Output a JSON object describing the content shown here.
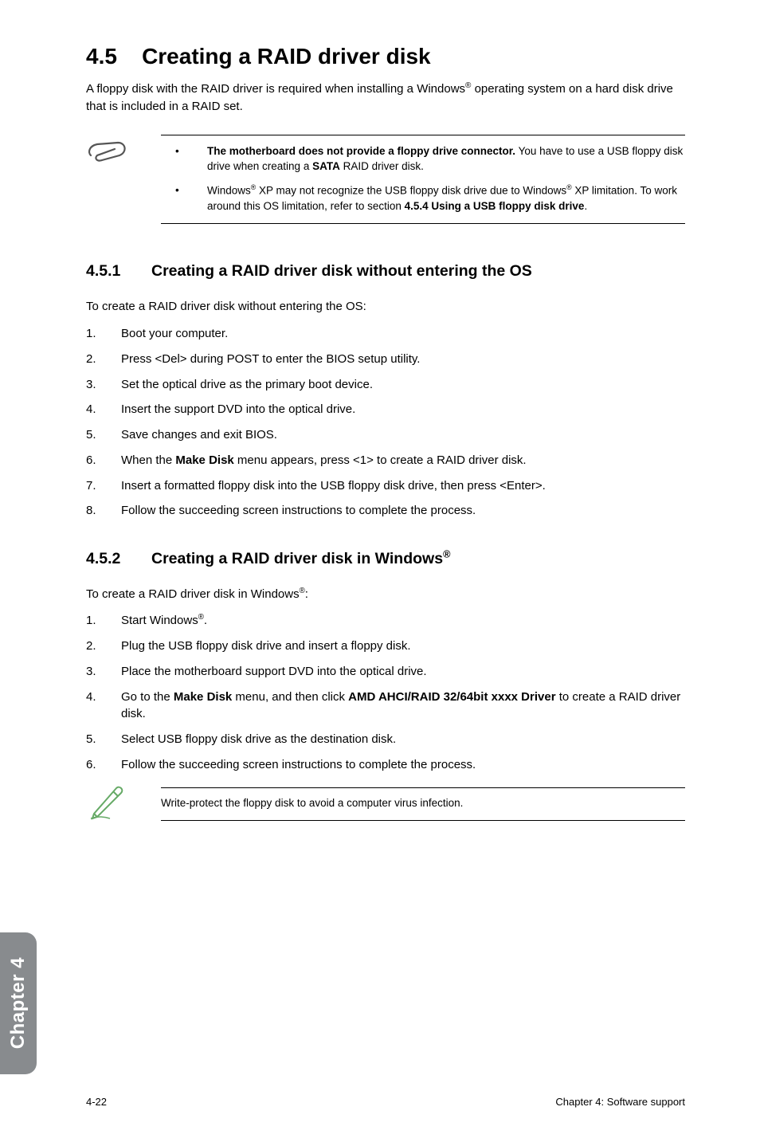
{
  "title": {
    "num": "4.5",
    "text": "Creating a RAID driver disk"
  },
  "intro": "A floppy disk with the RAID driver is required when installing a Windows® operating system on a hard disk drive that is included in a RAID set.",
  "note_items": [
    "<b>The motherboard does not provide a floppy drive connector.</b> You have to use a USB floppy disk drive when creating a <b>SATA</b> RAID driver disk.",
    "Windows<sup>®</sup> XP may not recognize the USB floppy disk drive due to Windows<sup>®</sup> XP limitation. To work around this OS limitation, refer to section <b>4.5.4 Using a USB floppy disk drive</b>."
  ],
  "sub1": {
    "num": "4.5.1",
    "title": "Creating a RAID driver disk without entering the OS",
    "lead": "To create a RAID driver disk without entering the OS:",
    "steps": [
      "Boot your computer.",
      "Press <Del> during POST to enter the BIOS setup utility.",
      "Set the optical drive as the primary boot device.",
      "Insert the support DVD into the optical drive.",
      "Save changes and exit BIOS.",
      "When the <b>Make Disk</b> menu appears, press <1> to create a RAID driver disk.",
      "Insert a formatted floppy disk into the USB floppy disk drive, then press <Enter>.",
      "Follow the succeeding screen instructions to complete the process."
    ]
  },
  "sub2": {
    "num": "4.5.2",
    "title": "Creating a RAID driver disk in Windows<sup>®</sup>",
    "lead": "To create a RAID driver disk in Windows<sup>®</sup>:",
    "steps": [
      "Start Windows<sup>®</sup>.",
      "Plug the USB floppy disk drive and insert a floppy disk.",
      "Place the motherboard support DVD into the optical drive.",
      "Go to the <b>Make Disk</b> menu, and then click <b>AMD AHCI/RAID 32/64bit xxxx Driver</b> to create a RAID driver disk.",
      "Select USB floppy disk drive as the destination disk.",
      "Follow the succeeding screen instructions to complete the process."
    ]
  },
  "tip": "Write-protect the floppy disk to avoid a computer virus infection.",
  "sidebar": "Chapter 4",
  "footer_left": "4-22",
  "footer_right": "Chapter 4: Software support"
}
